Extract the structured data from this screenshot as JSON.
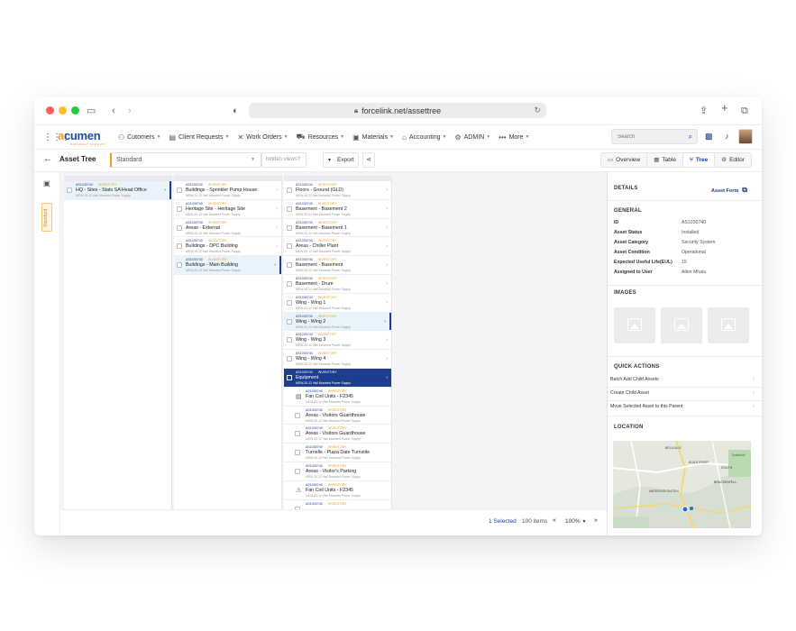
{
  "browser": {
    "url": "forcelink.net/assettree"
  },
  "logo": {
    "name": "acumen",
    "sub": "software support"
  },
  "nav": {
    "items": [
      {
        "label": "Cutomers",
        "icon": "users-icon"
      },
      {
        "label": "Client Requests",
        "icon": "clipboard-icon"
      },
      {
        "label": "Work Orders",
        "icon": "tools-icon"
      },
      {
        "label": "Resources",
        "icon": "truck-icon"
      },
      {
        "label": "Materials",
        "icon": "box-icon"
      },
      {
        "label": "Accounting",
        "icon": "bank-icon"
      },
      {
        "label": "ADMIN",
        "icon": "gear-icon"
      },
      {
        "label": "More",
        "icon": "dots-icon"
      }
    ],
    "search_placeholder": "Search"
  },
  "toolbar": {
    "title": "Asset Tree",
    "view": "Standard",
    "hidden_views": "hidden views?",
    "export": "Export",
    "tabs": [
      {
        "label": "Overview",
        "active": false
      },
      {
        "label": "Table",
        "active": false
      },
      {
        "label": "Tree",
        "active": true
      },
      {
        "label": "Editor",
        "active": false
      }
    ]
  },
  "sidebar": {
    "standard_label": "Standard"
  },
  "columns": [
    {
      "rows": [
        {
          "code": "AS1030740",
          "tag": "INVENTORY",
          "name": "HQ - Sites - Stats SA Head Office",
          "sub": "MEW-20-12 Hall Mounted Power Supply",
          "state": "selected"
        }
      ]
    },
    {
      "rows": [
        {
          "code": "AS1030740",
          "tag": "INVENTORY",
          "name": "Buildings - Sprinkler Pump House",
          "sub": "MEW-20-12 Hall Mounted Power Supply",
          "state": ""
        },
        {
          "code": "AS1030740",
          "tag": "INVENTORY",
          "name": "Heritage Site - Heritage Site",
          "sub": "MEW-20-12 Hall Mounted Power Supply",
          "state": ""
        },
        {
          "code": "AS1030740",
          "tag": "INVENTORY",
          "name": "Areas - External",
          "sub": "MEW-20-12 Hall Mounted Power Supply",
          "state": ""
        },
        {
          "code": "AS1030740",
          "tag": "INVENTORY",
          "name": "Buildings - DPC Building",
          "sub": "MEW-20-12 Hall Mounted Power Supply",
          "state": ""
        },
        {
          "code": "AS1030740",
          "tag": "INVENTORY",
          "name": "Buildings - Main Building",
          "sub": "MEW-20-12 Hall Mounted Power Supply",
          "state": "selected"
        }
      ]
    },
    {
      "rows": [
        {
          "code": "AS1030740",
          "tag": "INVENTORY",
          "name": "Floors - Ground (GLD)",
          "sub": "MEW-20-12 Hall Mounted Power Supply",
          "state": ""
        },
        {
          "code": "AS1030740",
          "tag": "INVENTORY",
          "name": "Basement - Basement 2",
          "sub": "MEW-20-12 Hall Mounted Power Supply",
          "state": ""
        },
        {
          "code": "AS1030740",
          "tag": "INVENTORY",
          "name": "Basement - Basement 1",
          "sub": "MEW-20-12 Hall Mounted Power Supply",
          "state": ""
        },
        {
          "code": "AS1030740",
          "tag": "INVENTORY",
          "name": "Areas - Chiller Plant",
          "sub": "MEW-20-12 Hall Mounted Power Supply",
          "state": ""
        },
        {
          "code": "AS1030740",
          "tag": "INVENTORY",
          "name": "Basement - Basement",
          "sub": "MEW-20-12 Hall Mounted Power Supply",
          "state": ""
        },
        {
          "code": "AS1030740",
          "tag": "INVENTORY",
          "name": "Basement - Drum",
          "sub": "MEW-20-12 Hall Mounted Power Supply",
          "state": ""
        },
        {
          "code": "AS1030740",
          "tag": "INVENTORY",
          "name": "Wing - Wing 1",
          "sub": "MEW-20-12 Hall Mounted Power Supply",
          "state": ""
        },
        {
          "code": "AS1030740",
          "tag": "INVENTORY",
          "name": "Wing - Wing 2",
          "sub": "MEW-20-12 Hall Mounted Power Supply",
          "state": "selected"
        },
        {
          "code": "AS1030740",
          "tag": "INVENTORY",
          "name": "Wing - Wing 3",
          "sub": "MEW-20-12 Hall Mounted Power Supply",
          "state": ""
        },
        {
          "code": "AS1030740",
          "tag": "INVENTORY",
          "name": "Wing - Wing 4",
          "sub": "MEW-20-12 Hall Mounted Power Supply",
          "state": ""
        },
        {
          "code": "AS1030740",
          "tag": "INVENTORY",
          "name": "Equipment",
          "sub": "MEW-20-12 Hall Mounted Power Supply",
          "state": "active"
        },
        {
          "code": "AS1030740",
          "tag": "INVENTORY",
          "name": "Fan Coil Units - F2345",
          "sub": "MEW-20-12 Hall Mounted Power Supply",
          "state": "child-icon"
        },
        {
          "code": "AS1030740",
          "tag": "INVENTORY",
          "name": "Areas - Visitors Guardhouse",
          "sub": "MEW-20-12 Hall Mounted Power Supply",
          "state": "child"
        },
        {
          "code": "AS1030740",
          "tag": "INVENTORY",
          "name": "Areas - Visitors Guardhouse",
          "sub": "MEW-20-12 Hall Mounted Power Supply",
          "state": "child"
        },
        {
          "code": "AS1030740",
          "tag": "INVENTORY",
          "name": "Turnelle - Plaza Date Turnstile",
          "sub": "MEW-20-12 Hall Mounted Power Supply",
          "state": "child"
        },
        {
          "code": "AS1030740",
          "tag": "INVENTORY",
          "name": "Areas - Visitor's Parking",
          "sub": "MEW-20-12 Hall Mounted Power Supply",
          "state": "child"
        },
        {
          "code": "AS1030740",
          "tag": "INVENTORY",
          "name": "Fan Coil Units - F2345",
          "sub": "MEW-20-12 Hall Mounted Power Supply",
          "state": "child-icon2"
        },
        {
          "code": "AS1030740",
          "tag": "INVENTORY",
          "name": "",
          "sub": "",
          "state": "child"
        }
      ]
    }
  ],
  "status": {
    "selected": "1 Selected",
    "items": "100 items",
    "zoom": "100%"
  },
  "details": {
    "title": "DETAILS",
    "asset_form": "Asset Form",
    "general": "GENERAL",
    "fields": [
      {
        "k": "ID",
        "v": "AS1030740"
      },
      {
        "k": "Asset Status",
        "v": "Installed"
      },
      {
        "k": "Asset Category",
        "v": "Security System"
      },
      {
        "k": "Asset Condition",
        "v": "Operational"
      },
      {
        "k": "Expected Useful Life(EUL)",
        "v": "15"
      },
      {
        "k": "Assigned to User",
        "v": "Allen Mhatu"
      }
    ],
    "images": "IMAGES",
    "quick_actions": "QUICK ACTIONS",
    "actions": [
      "Batch Add Child Assets",
      "Create Child Asset",
      "Move Selected Asset to this Parent"
    ],
    "location": "LOCATION",
    "map_labels": [
      "BELLVILLE",
      "KUILS RIVER",
      "SOUTH",
      "Sulderholt",
      "BRACKENFELL",
      "MATROOSFONTEIN"
    ]
  },
  "colors": {
    "primary": "#1d3d8f",
    "accent": "#f39c1f",
    "selected_row": "#e8f3fb"
  }
}
